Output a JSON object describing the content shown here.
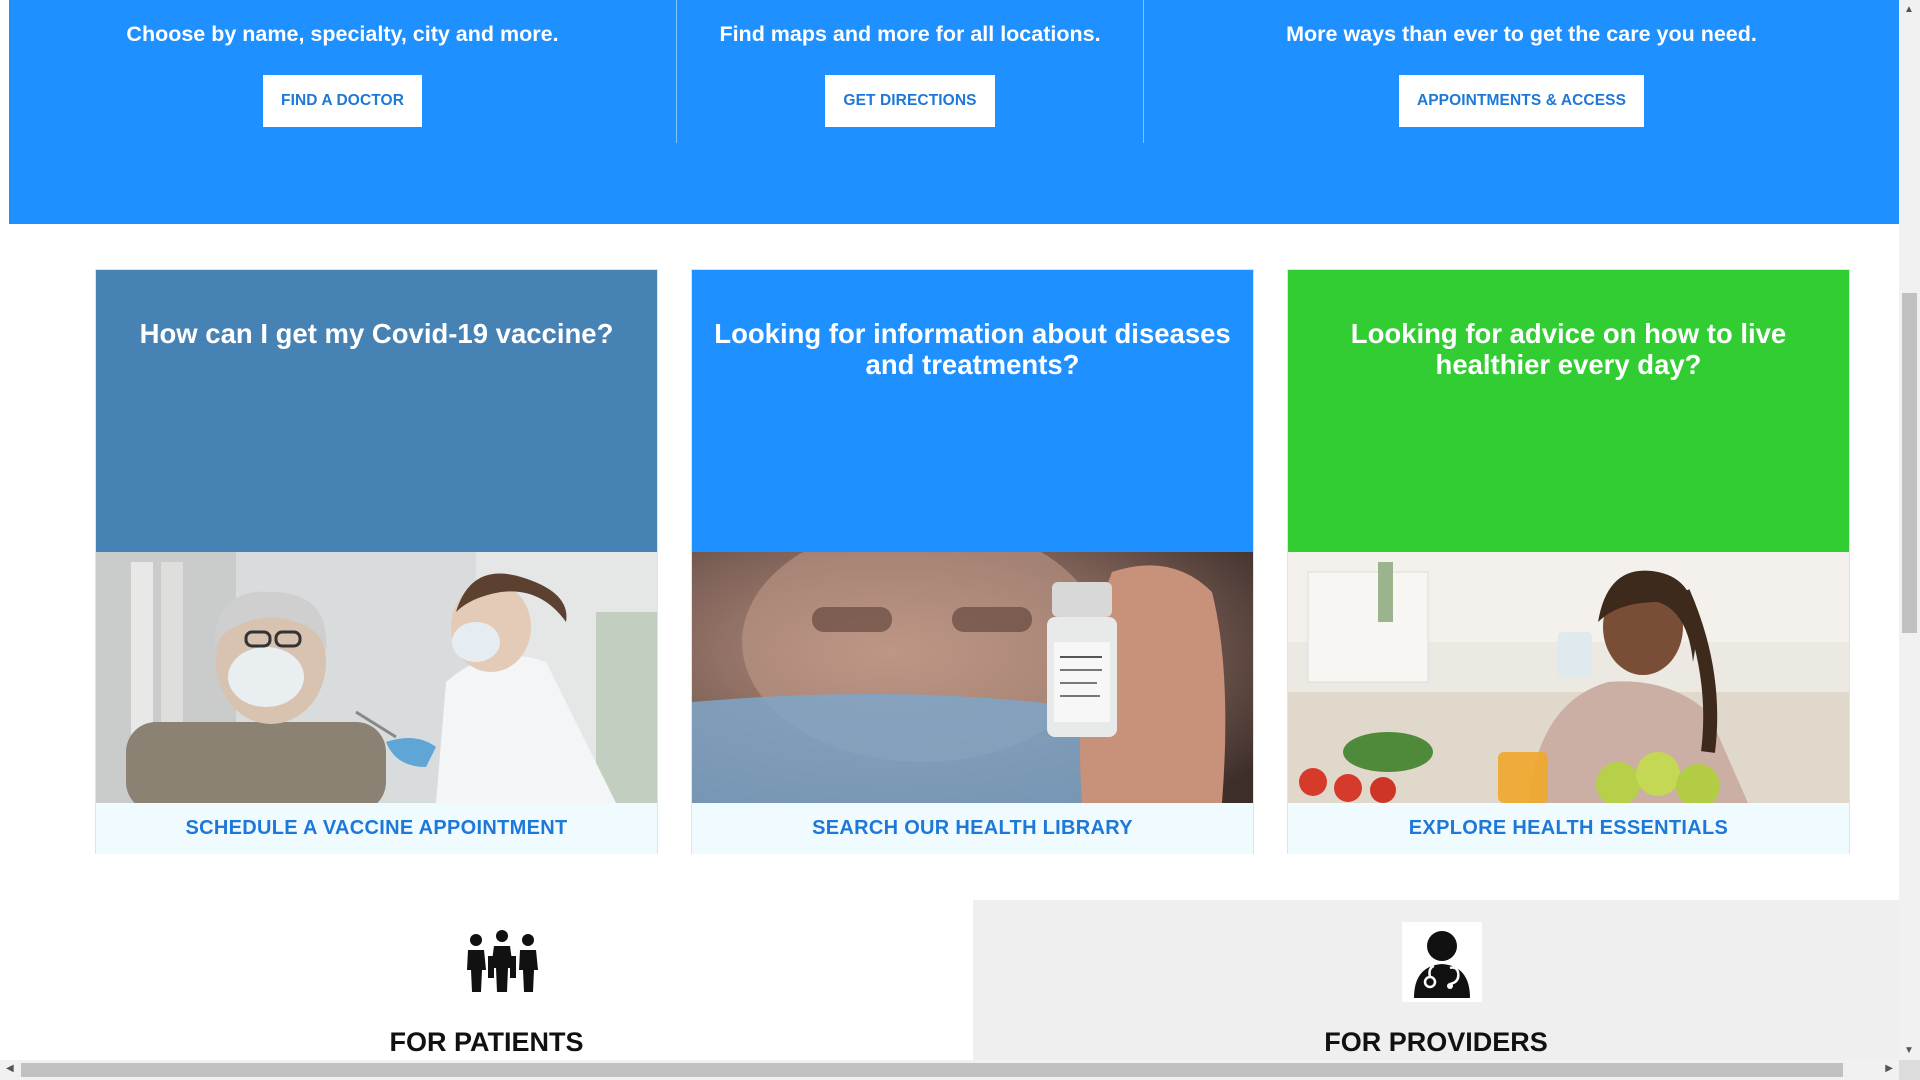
{
  "top": {
    "columns": [
      {
        "text": "Choose by name, specialty, city and more.",
        "button": "FIND A DOCTOR"
      },
      {
        "text": "Find maps and more for all locations.",
        "button": "GET DIRECTIONS"
      },
      {
        "text": "More ways than ever to get the care you need.",
        "button": "APPOINTMENTS & ACCESS"
      }
    ],
    "background": "#1e90ff"
  },
  "cards": [
    {
      "heading": "How can I get my Covid-19 vaccine?",
      "link": "SCHEDULE A VACCINE APPOINTMENT",
      "color": "#4682b4",
      "image": "nurse-vaccinating-senior-woman-photo"
    },
    {
      "heading": "Looking for information about diseases and treatments?",
      "link": "SEARCH OUR HEALTH LIBRARY",
      "color": "#1e90ff",
      "image": "hand-holding-vaccine-vial-photo"
    },
    {
      "heading": "Looking for advice on how to live healthier every day?",
      "link": "EXPLORE HEALTH ESSENTIALS",
      "color": "#32cd32",
      "image": "woman-drinking-water-kitchen-photo"
    }
  ],
  "sections": {
    "patients": {
      "title": "FOR PATIENTS",
      "icon": "family-group-icon"
    },
    "providers": {
      "title": "FOR PROVIDERS",
      "icon": "doctor-stethoscope-icon"
    }
  },
  "link_color": "#1e78d8"
}
